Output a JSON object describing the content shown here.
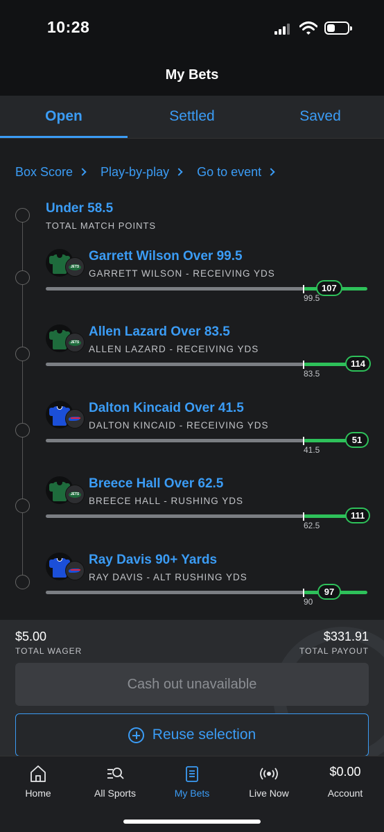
{
  "status_bar": {
    "time": "10:28"
  },
  "header": {
    "title": "My Bets"
  },
  "tabs": [
    {
      "label": "Open",
      "active": true
    },
    {
      "label": "Settled",
      "active": false
    },
    {
      "label": "Saved",
      "active": false
    }
  ],
  "links": [
    {
      "label": "Box Score"
    },
    {
      "label": "Play-by-play"
    },
    {
      "label": "Go to event"
    }
  ],
  "parlay": {
    "title": "Under 58.5",
    "subtitle": "TOTAL MATCH POINTS"
  },
  "legs": [
    {
      "title": "Garrett Wilson Over 99.5",
      "subtitle": "GARRETT WILSON - RECEIVING YDS",
      "threshold": "99.5",
      "value": "107",
      "team": "jets"
    },
    {
      "title": "Allen Lazard Over 83.5",
      "subtitle": "ALLEN LAZARD - RECEIVING YDS",
      "threshold": "83.5",
      "value": "114",
      "team": "jets"
    },
    {
      "title": "Dalton Kincaid Over 41.5",
      "subtitle": "DALTON KINCAID - RECEIVING YDS",
      "threshold": "41.5",
      "value": "51",
      "team": "bills"
    },
    {
      "title": "Breece Hall Over 62.5",
      "subtitle": "BREECE HALL - RUSHING YDS",
      "threshold": "62.5",
      "value": "111",
      "team": "jets"
    },
    {
      "title": "Ray Davis 90+ Yards",
      "subtitle": "RAY DAVIS - ALT RUSHING YDS",
      "threshold": "90",
      "value": "97",
      "team": "bills"
    }
  ],
  "footer": {
    "wager_amount": "$5.00",
    "wager_label": "TOTAL WAGER",
    "payout_amount": "$331.91",
    "payout_label": "TOTAL PAYOUT",
    "cashout_label": "Cash out unavailable",
    "reuse_label": "Reuse selection"
  },
  "nav": {
    "home": "Home",
    "all_sports": "All Sports",
    "my_bets": "My Bets",
    "live_now": "Live Now",
    "balance": "$0.00",
    "account": "Account"
  },
  "colors": {
    "accent": "#3b9cf5",
    "win": "#2ec15a",
    "jets_green": "#1e6b3c",
    "bills_blue": "#1b4fd8"
  }
}
